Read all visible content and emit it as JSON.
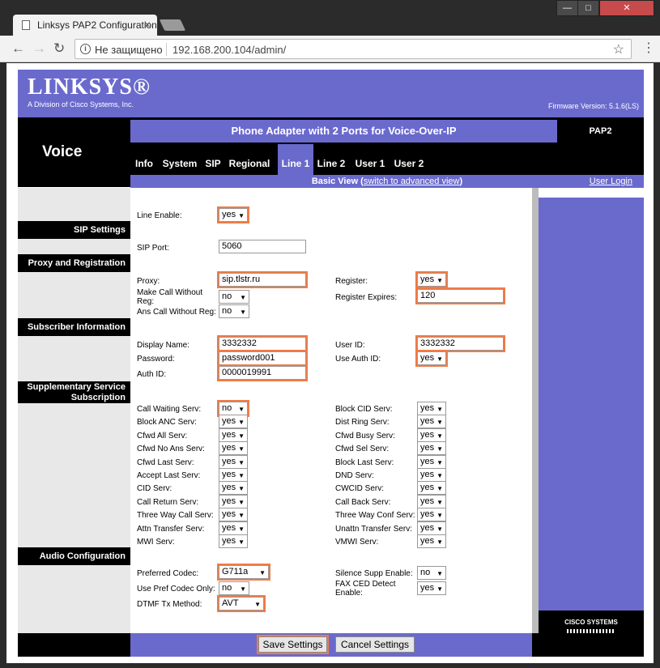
{
  "browser": {
    "tab_title": "Linksys PAP2 Configuration",
    "tab_close": "×",
    "not_secure": "Не защищено",
    "url": "192.168.200.104/admin/",
    "win_min": "—",
    "win_max": "□",
    "win_close": "✕"
  },
  "header": {
    "logo": "LINKSYS®",
    "logo_sub": "A Division of Cisco Systems, Inc.",
    "firmware": "Firmware Version: 5.1.6(LS)",
    "section": "Voice",
    "product": "Phone Adapter with 2 Ports for Voice-Over-IP",
    "model": "PAP2",
    "tabs": [
      "Info",
      "System",
      "SIP",
      "Regional",
      "Line 1",
      "Line 2",
      "User 1",
      "User 2"
    ],
    "active_tab": "Line 1",
    "view_prefix": "Basic View (",
    "view_link": "switch to advanced view",
    "view_suffix": ")",
    "user_login": "User Login"
  },
  "sections": {
    "sip": "SIP Settings",
    "proxy": "Proxy and Registration",
    "subscriber": "Subscriber Information",
    "supp1": "Supplementary Service",
    "supp2": "Subscription",
    "audio": "Audio Configuration"
  },
  "fields": {
    "line_enable": {
      "label": "Line Enable:",
      "value": "yes"
    },
    "sip_port": {
      "label": "SIP Port:",
      "value": "5060"
    },
    "proxy": {
      "label": "Proxy:",
      "value": "sip.tlstr.ru"
    },
    "register": {
      "label": "Register:",
      "value": "yes"
    },
    "make_call_without_reg": {
      "label1": "Make Call Without",
      "label2": "Reg:",
      "value": "no"
    },
    "register_expires": {
      "label": "Register Expires:",
      "value": "120"
    },
    "ans_call_without_reg": {
      "label": "Ans Call Without Reg:",
      "value": "no"
    },
    "display_name": {
      "label": "Display Name:",
      "value": "3332332"
    },
    "user_id": {
      "label": "User ID:",
      "value": "3332332"
    },
    "password": {
      "label": "Password:",
      "value": "password001"
    },
    "use_auth_id": {
      "label": "Use Auth ID:",
      "value": "yes"
    },
    "auth_id": {
      "label": "Auth ID:",
      "value": "0000019991"
    },
    "preferred_codec": {
      "label": "Preferred Codec:",
      "value": "G711a"
    },
    "silence_supp": {
      "label": "Silence Supp Enable:",
      "value": "no"
    },
    "use_pref_codec_only": {
      "label": "Use Pref Codec Only:",
      "value": "no"
    },
    "fax_ced": {
      "label1": "FAX CED Detect",
      "label2": "Enable:",
      "value": "yes"
    },
    "dtmf": {
      "label": "DTMF Tx Method:",
      "value": "AVT"
    }
  },
  "supp_left": [
    {
      "label": "Call Waiting Serv:",
      "value": "no"
    },
    {
      "label": "Block ANC Serv:",
      "value": "yes"
    },
    {
      "label": "Cfwd All Serv:",
      "value": "yes"
    },
    {
      "label": "Cfwd No Ans Serv:",
      "value": "yes"
    },
    {
      "label": "Cfwd Last Serv:",
      "value": "yes"
    },
    {
      "label": "Accept Last Serv:",
      "value": "yes"
    },
    {
      "label": "CID Serv:",
      "value": "yes"
    },
    {
      "label": "Call Return Serv:",
      "value": "yes"
    },
    {
      "label": "Three Way Call Serv:",
      "value": "yes"
    },
    {
      "label": "Attn Transfer Serv:",
      "value": "yes"
    },
    {
      "label": "MWI Serv:",
      "value": "yes"
    }
  ],
  "supp_right": [
    {
      "label": "Block CID Serv:",
      "value": "yes"
    },
    {
      "label": "Dist Ring Serv:",
      "value": "yes"
    },
    {
      "label": "Cfwd Busy Serv:",
      "value": "yes"
    },
    {
      "label": "Cfwd Sel Serv:",
      "value": "yes"
    },
    {
      "label": "Block Last Serv:",
      "value": "yes"
    },
    {
      "label": "DND Serv:",
      "value": "yes"
    },
    {
      "label": "CWCID Serv:",
      "value": "yes"
    },
    {
      "label": "Call Back Serv:",
      "value": "yes"
    },
    {
      "label": "Three Way Conf Serv:",
      "value": "yes"
    },
    {
      "label": "Unattn Transfer Serv:",
      "value": "yes"
    },
    {
      "label": "VMWI Serv:",
      "value": "yes"
    }
  ],
  "buttons": {
    "save": "Save Settings",
    "cancel": "Cancel Settings"
  },
  "cisco": "CISCO SYSTEMS",
  "colors": {
    "brand_purple": "#6a6acd",
    "highlight": "#f07b45"
  }
}
